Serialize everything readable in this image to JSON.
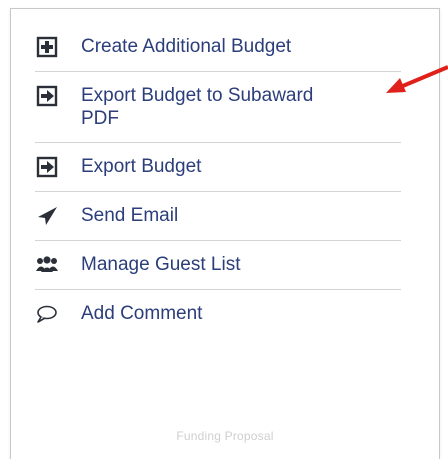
{
  "menu": {
    "items": [
      {
        "label": "Create Additional Budget",
        "icon": "plus-box-icon"
      },
      {
        "label": "Export Budget to Subaward\nPDF",
        "icon": "export-icon"
      },
      {
        "label": "Export Budget",
        "icon": "export-icon"
      },
      {
        "label": "Send Email",
        "icon": "paper-plane-icon"
      },
      {
        "label": "Manage Guest List",
        "icon": "users-icon"
      },
      {
        "label": "Add Comment",
        "icon": "comment-icon"
      }
    ]
  },
  "footer": {
    "text": "Funding Proposal"
  },
  "colors": {
    "link": "#2b3e7a",
    "icon": "#2a2f38",
    "divider": "#d4d4d4",
    "annotation_arrow": "#e0211b"
  }
}
